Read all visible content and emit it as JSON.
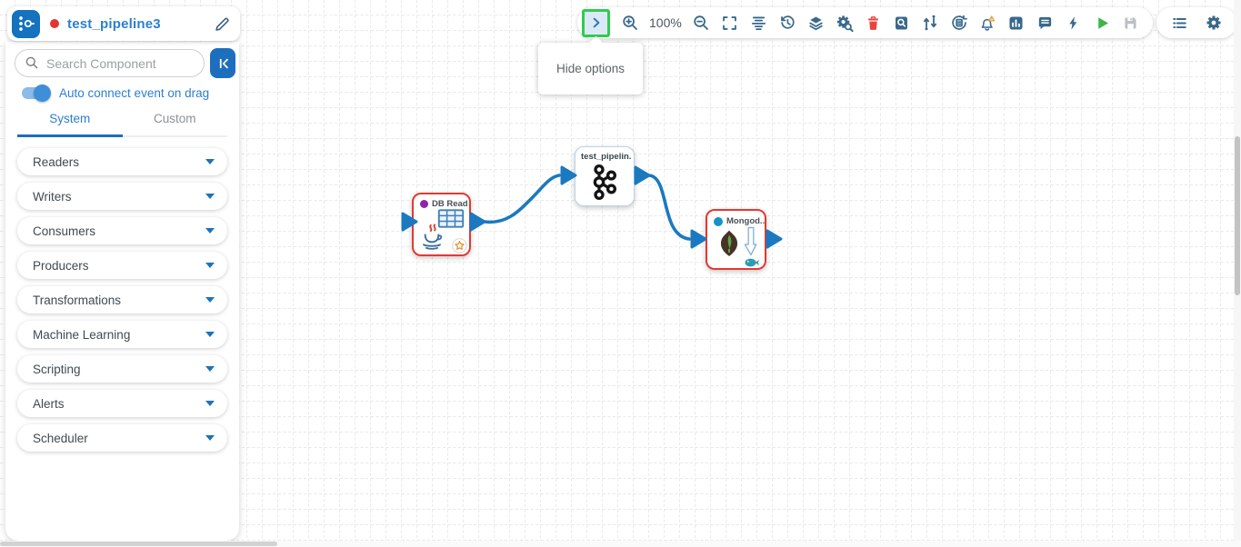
{
  "header": {
    "pipeline_name": "test_pipeline3",
    "status_dot_color": "#e4342e"
  },
  "sidebar": {
    "search_placeholder": "Search Component",
    "auto_connect_label": "Auto connect event on drag",
    "tabs": [
      {
        "label": "System",
        "active": true
      },
      {
        "label": "Custom",
        "active": false
      }
    ],
    "categories": [
      {
        "label": "Readers"
      },
      {
        "label": "Writers"
      },
      {
        "label": "Consumers"
      },
      {
        "label": "Producers"
      },
      {
        "label": "Transformations"
      },
      {
        "label": "Machine Learning"
      },
      {
        "label": "Scripting"
      },
      {
        "label": "Alerts"
      },
      {
        "label": "Scheduler"
      }
    ]
  },
  "toolbar": {
    "zoom_level": "100%",
    "tooltip": "Hide options",
    "icons": [
      "hide-options-chevron",
      "zoom-in",
      "zoom-out",
      "fit-screen",
      "align-center",
      "history",
      "layers",
      "pipeline-settings-search",
      "delete",
      "inspect-data",
      "reroute-connections",
      "restore-version",
      "alert-bell",
      "statistics-chart",
      "comments",
      "trigger-bolt",
      "run-play",
      "save-disk"
    ],
    "right_icons": [
      "list-view",
      "settings-gear"
    ]
  },
  "canvas": {
    "nodes": [
      {
        "label": "DB Read...",
        "type": "db-reader",
        "border_color": "#e23a33",
        "dot_color": "#8e24aa"
      },
      {
        "label": "test_pipelin...",
        "type": "kafka",
        "border_color": "#b9d3e4",
        "dot_color": ""
      },
      {
        "label": "Mongod...",
        "type": "mongodb",
        "border_color": "#e23a33",
        "dot_color": "#1793c8"
      }
    ],
    "edge_color": "#1b79c0"
  },
  "colors": {
    "accent_blue": "#2b7fd0",
    "toolbar_icon": "#38688c",
    "highlight_green": "#2fcc4e",
    "port_blue": "#1b79c0"
  }
}
